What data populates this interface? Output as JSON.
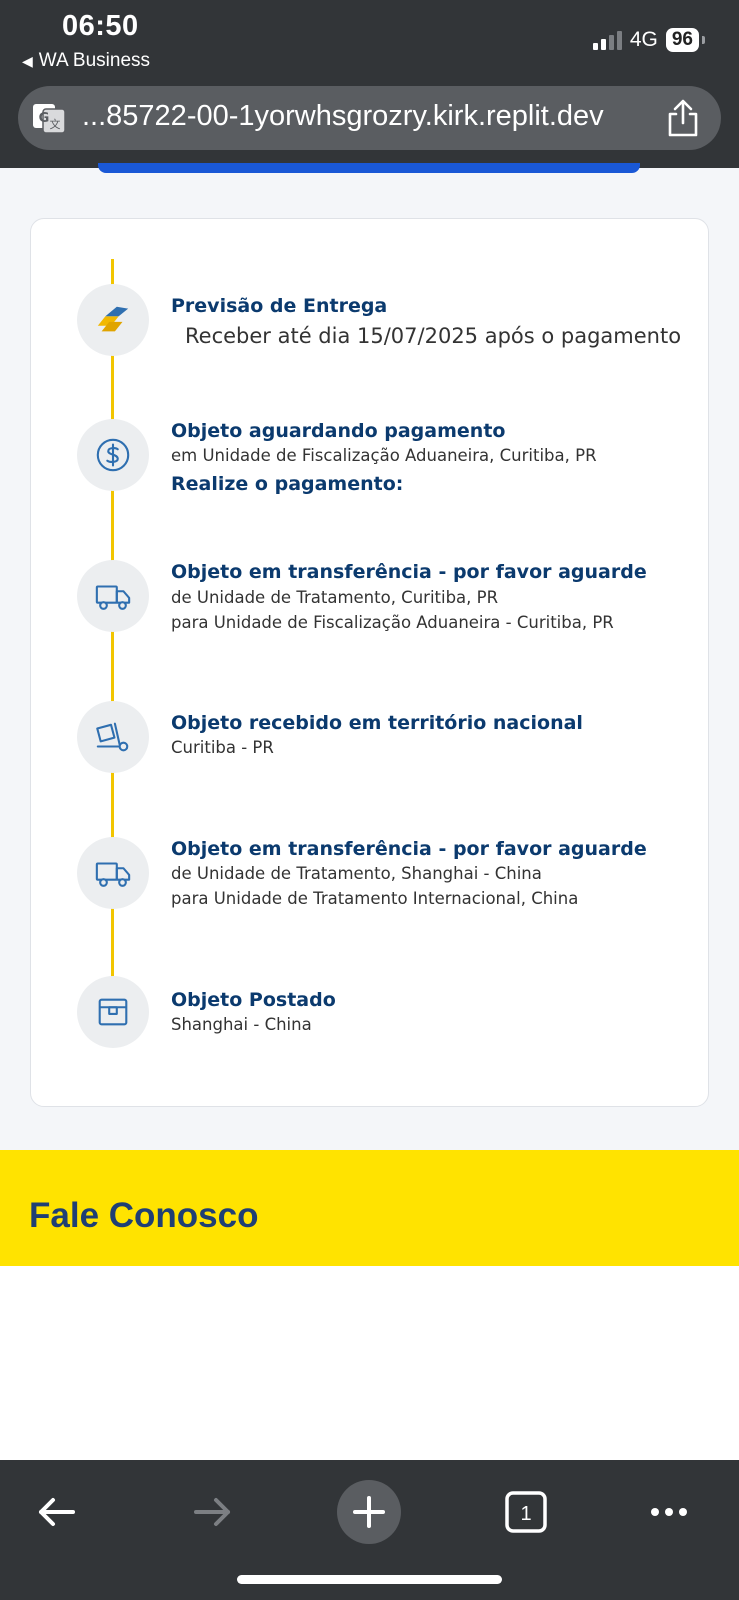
{
  "status_bar": {
    "time": "06:50",
    "back_app": "WA Business",
    "network": "4G",
    "battery": "96"
  },
  "browser": {
    "url": "...85722-00-1yorwhsgrozry.kirk.replit.dev",
    "translate_icon": "translate-icon",
    "share_icon": "share-icon"
  },
  "tracking": {
    "steps": [
      {
        "icon": "correios-logo-icon",
        "title": "Previsão de Entrega",
        "lines": [
          "Receber até dia 15/07/2025 após o pagamento"
        ]
      },
      {
        "icon": "dollar-icon",
        "title": "Objeto aguardando pagamento",
        "lines": [
          "em Unidade de Fiscalização Aduaneira, Curitiba, PR"
        ],
        "action": "Realize o pagamento:"
      },
      {
        "icon": "truck-icon",
        "title": "Objeto em transferência - por favor aguarde",
        "lines": [
          "de Unidade de Tratamento, Curitiba, PR",
          "para Unidade de Fiscalização Aduaneira - Curitiba, PR"
        ]
      },
      {
        "icon": "hand-truck-icon",
        "title": "Objeto recebido em território nacional",
        "lines": [
          "Curitiba - PR"
        ]
      },
      {
        "icon": "truck-icon",
        "title": "Objeto em transferência - por favor aguarde",
        "lines": [
          "de Unidade de Tratamento, Shanghai - China",
          "para Unidade de Tratamento Internacional, China"
        ]
      },
      {
        "icon": "box-icon",
        "title": "Objeto Postado",
        "lines": [
          "Shanghai - China"
        ]
      }
    ]
  },
  "footer": {
    "title": "Fale Conosco"
  },
  "toolbar": {
    "tab_count": "1"
  },
  "colors": {
    "accent_yellow": "#ffe300",
    "timeline_yellow": "#f2c500",
    "title_blue": "#0b3a6e",
    "footer_blue": "#1f3f74",
    "icon_blue": "#2f6fb0"
  }
}
